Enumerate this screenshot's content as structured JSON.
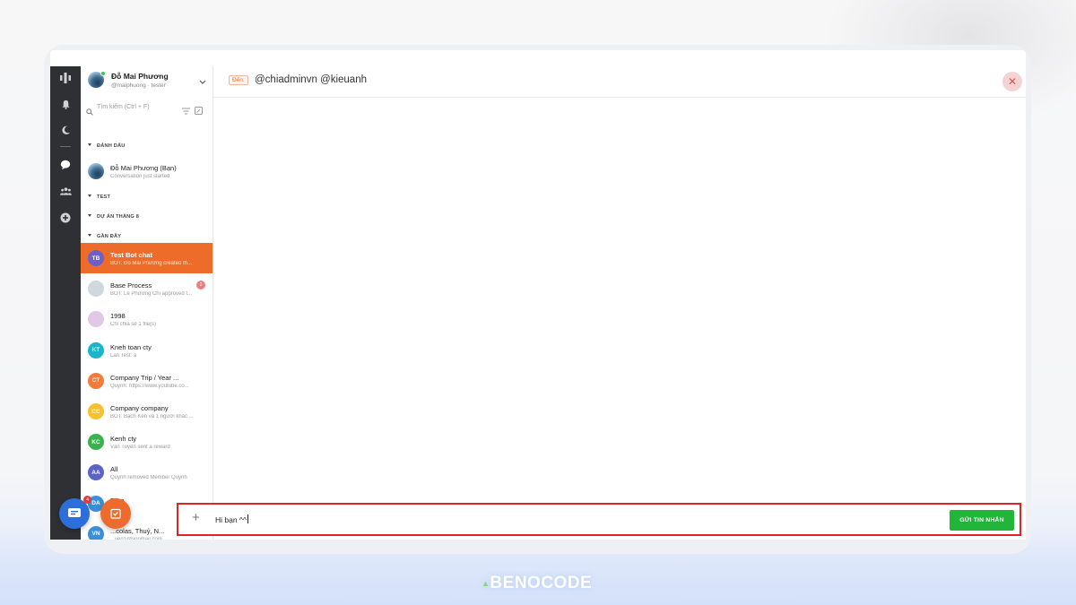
{
  "profile": {
    "name": "Đỗ Mai Phương",
    "handle": "@maiphuong · tester"
  },
  "search": {
    "placeholder": "Tìm kiếm (Ctrl + F)"
  },
  "sections": {
    "marked": "ĐÁNH DẤU",
    "test": "TEST",
    "project": "DỰ ÁN THÁNG 8",
    "recent": "GẦN ĐÂY"
  },
  "marked_conversation": {
    "title": "Đỗ Mai Phương (Bạn)",
    "preview": "Conversation just started"
  },
  "conversations": [
    {
      "initials": "TB",
      "title": "Test Bot chat",
      "preview": "BOT: Đỗ Mai Phương created th...",
      "color": "#6f5fc8",
      "active": true
    },
    {
      "initials": "",
      "title": "Base Process",
      "preview": "BOT: Lê Phương Chi approved t...",
      "color": "#cfd8df",
      "badge": "2"
    },
    {
      "initials": "",
      "title": "1998",
      "preview": "Chi chia sẻ 1 file(s)",
      "color": "#e1c8e6"
    },
    {
      "initials": "KT",
      "title": "Kneh toan cty",
      "preview": "Lan Test: a",
      "color": "#19b5c9"
    },
    {
      "initials": "CT",
      "title": "Company Trip / Year ...",
      "preview": "Quỳnh: https://www.youtube.co...",
      "color": "#f27a3a"
    },
    {
      "initials": "CC",
      "title": "Company company",
      "preview": "BOT: Bạch Kến và 1 người khác ...",
      "color": "#f6c12d"
    },
    {
      "initials": "KC",
      "title": "Kenh cty",
      "preview": "Vân Tuyền sent a reward",
      "color": "#37b24d"
    },
    {
      "initials": "AA",
      "title": "All",
      "preview": "Quỳnh removed Member Quỳnh",
      "color": "#5b63c9"
    },
    {
      "initials": "DA",
      "title": "D2 a",
      "preview": "Hoa: trr",
      "color": "#3b8fd8"
    },
    {
      "initials": "VN",
      "title": "...colas, Thuỷ, N...",
      "preview": "...yen1@yopmail.com",
      "color": "#3b8fd8"
    }
  ],
  "fab": {
    "chat_badge": "4"
  },
  "compose": {
    "to_label": "Đến:",
    "recipients": "@chiadminvn @kieuanh",
    "message": "Hi bạn ^^",
    "send_label": "GỬI TIN NHẮN"
  },
  "brand": {
    "name": "BENOCODE"
  }
}
